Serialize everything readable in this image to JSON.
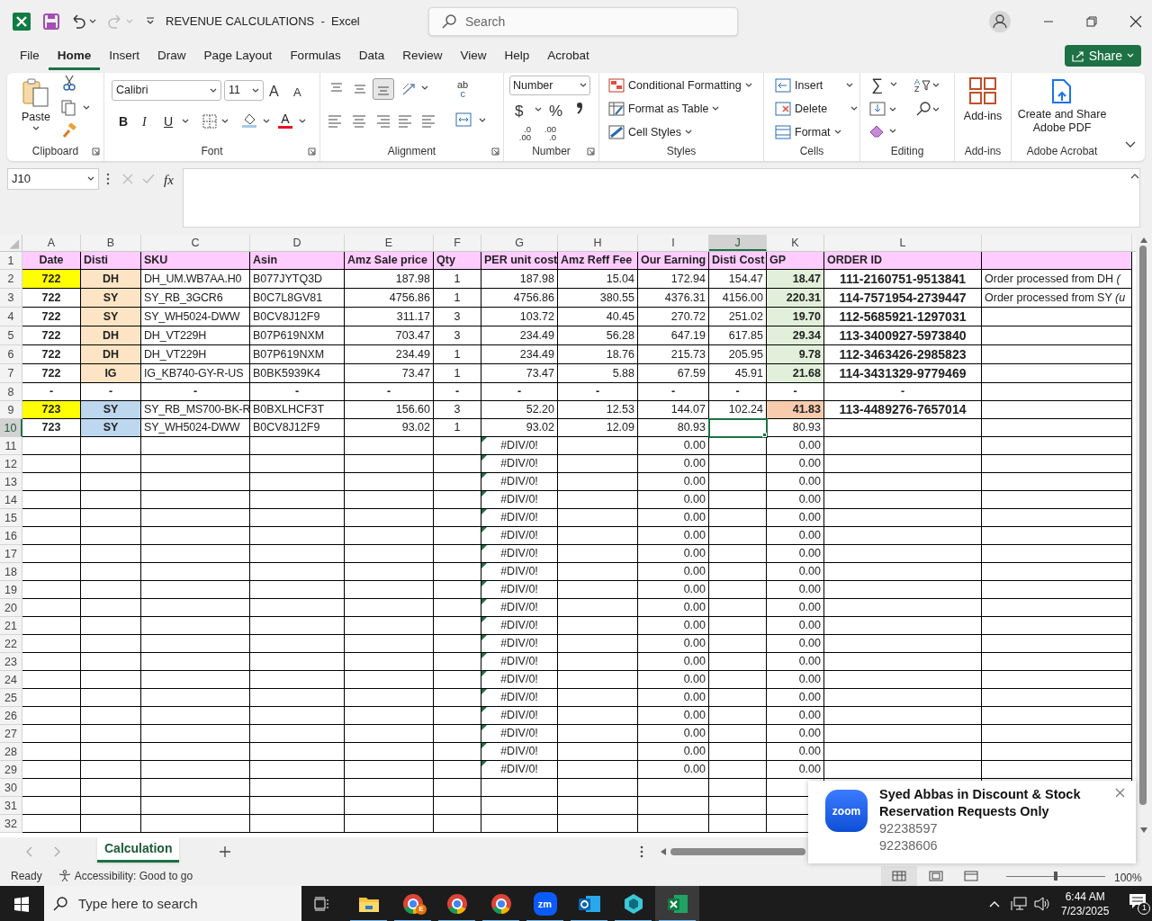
{
  "title_bar": {
    "title": "REVENUE CALCULATIONS  -  Excel",
    "search_placeholder": "Search"
  },
  "menu_tabs": [
    {
      "label": "File",
      "selected": false
    },
    {
      "label": "Home",
      "selected": true
    },
    {
      "label": "Insert",
      "selected": false
    },
    {
      "label": "Draw",
      "selected": false
    },
    {
      "label": "Page Layout",
      "selected": false
    },
    {
      "label": "Formulas",
      "selected": false
    },
    {
      "label": "Data",
      "selected": false
    },
    {
      "label": "Review",
      "selected": false
    },
    {
      "label": "View",
      "selected": false
    },
    {
      "label": "Help",
      "selected": false
    },
    {
      "label": "Acrobat",
      "selected": false
    }
  ],
  "share_button": "Share",
  "ribbon": {
    "paste": "Paste",
    "font_name": "Calibri",
    "font_size": "11",
    "grow_shrink": [
      "A",
      "A"
    ],
    "font_buttons": [
      "B",
      "I",
      "U"
    ],
    "font_color": "A",
    "vertical_align": [
      {
        "selected": false
      },
      {
        "selected": false
      },
      {
        "selected": true
      }
    ],
    "wrap_icon": [
      "ab",
      "c"
    ],
    "number_format": "Number",
    "number_symbols": [
      "$",
      "%"
    ],
    "decimal_buttons": [
      {
        "top": ".0",
        "bottom": ".00"
      },
      {
        "top": ".00",
        "bottom": ".0"
      }
    ],
    "styles": [
      "Conditional Formatting",
      "Format as Table",
      "Cell Styles"
    ],
    "cells": [
      "Insert",
      "Delete",
      "Format"
    ],
    "autosum": "∑",
    "sort_icon": [
      "A",
      "Z"
    ],
    "add_ins": "Add-ins",
    "acrobat": "Create and Share Adobe PDF",
    "group_labels": [
      "Clipboard",
      "Font",
      "Alignment",
      "Number",
      "Styles",
      "Cells",
      "Editing",
      "Add-ins",
      "Adobe Acrobat"
    ]
  },
  "formula_bar": {
    "name_box": "J10",
    "fx": "fx"
  },
  "sheet": {
    "columns": [
      {
        "letter": "A",
        "selected": false
      },
      {
        "letter": "B",
        "selected": false
      },
      {
        "letter": "C",
        "selected": false
      },
      {
        "letter": "D",
        "selected": false
      },
      {
        "letter": "E",
        "selected": false
      },
      {
        "letter": "F",
        "selected": false
      },
      {
        "letter": "G",
        "selected": false
      },
      {
        "letter": "H",
        "selected": false
      },
      {
        "letter": "I",
        "selected": false
      },
      {
        "letter": "J",
        "selected": true
      },
      {
        "letter": "K",
        "selected": false
      },
      {
        "letter": "L",
        "selected": false
      }
    ],
    "rows": [
      {
        "number": "1",
        "kind": "header",
        "selected": false,
        "color": "#ffccff",
        "cells": {
          "A": "Date",
          "B": "Disti",
          "C": "SKU",
          "D": "Asin",
          "E": "Amz Sale price",
          "F": "Qty",
          "G": "PER unit cost",
          "H": "Amz Reff Fee",
          "I": "Our Earning",
          "J": "Disti Cost",
          "K": "GP",
          "L": "ORDER ID"
        }
      },
      {
        "number": "2",
        "kind": "data",
        "selected": false,
        "cells": {
          "A": {
            "text": "722",
            "color": "#ffff00"
          },
          "B": {
            "text": "DH",
            "color": "#fce4c4"
          },
          "C": "DH_UM.WB7AA.H0",
          "D": "B077JYTQ3D",
          "E": "187.98",
          "F": "1",
          "G": "187.98",
          "H": "15.04",
          "I": "172.94",
          "J": "154.47",
          "K": {
            "text": "18.47",
            "color": "#e2efda"
          },
          "L": "111-2160751-9513841",
          "M": "Order processed from DH *(*"
        }
      },
      {
        "number": "3",
        "kind": "data",
        "selected": false,
        "cells": {
          "A": "722",
          "B": {
            "text": "SY",
            "color": "#fce4c4"
          },
          "C": "SY_RB_3GCR6",
          "D": "B0C7L8GV81",
          "E": "4756.86",
          "F": "1",
          "G": "4756.86",
          "H": "380.55",
          "I": "4376.31",
          "J": "4156.00",
          "K": {
            "text": "220.31",
            "color": "#e2efda"
          },
          "L": "114-7571954-2739447",
          "M": "Order processed from SY *(u*"
        }
      },
      {
        "number": "4",
        "kind": "data",
        "selected": false,
        "cells": {
          "A": "722",
          "B": {
            "text": "SY",
            "color": "#fce4c4"
          },
          "C": "SY_WH5024-DWW",
          "D": "B0CV8J12F9",
          "E": "311.17",
          "F": "3",
          "G": "103.72",
          "H": "40.45",
          "I": "270.72",
          "J": "251.02",
          "K": {
            "text": "19.70",
            "color": "#e2efda"
          },
          "L": "112-5685921-1297031"
        }
      },
      {
        "number": "5",
        "kind": "data",
        "selected": false,
        "cells": {
          "A": "722",
          "B": {
            "text": "DH",
            "color": "#fce4c4"
          },
          "C": "DH_VT229H",
          "D": "B07P619NXM",
          "E": "703.47",
          "F": "3",
          "G": "234.49",
          "H": "56.28",
          "I": "647.19",
          "J": "617.85",
          "K": {
            "text": "29.34",
            "color": "#e2efda"
          },
          "L": "113-3400927-5973840"
        }
      },
      {
        "number": "6",
        "kind": "data",
        "selected": false,
        "cells": {
          "A": "722",
          "B": {
            "text": "DH",
            "color": "#fce4c4"
          },
          "C": "DH_VT229H",
          "D": "B07P619NXM",
          "E": "234.49",
          "F": "1",
          "G": "234.49",
          "H": "18.76",
          "I": "215.73",
          "J": "205.95",
          "K": {
            "text": "9.78",
            "color": "#e2efda"
          },
          "L": "112-3463426-2985823"
        }
      },
      {
        "number": "7",
        "kind": "data",
        "selected": false,
        "cells": {
          "A": "722",
          "B": {
            "text": "IG",
            "color": "#fce4c4"
          },
          "C": "IG_KB740-GY-R-US",
          "D": "B0BK5939K4",
          "E": "73.47",
          "F": "1",
          "G": "73.47",
          "H": "5.88",
          "I": "67.59",
          "J": "45.91",
          "K": {
            "text": "21.68",
            "color": "#e2efda"
          },
          "L": "114-3431329-9779469"
        }
      },
      {
        "number": "8",
        "kind": "separator",
        "selected": false,
        "cells": {
          "A": "-",
          "B": "-",
          "C": "-",
          "D": "-",
          "E": "-",
          "F": "-",
          "G": "-",
          "H": "-",
          "I": "-",
          "J": "-",
          "K": "-",
          "L": "-"
        }
      },
      {
        "number": "9",
        "kind": "data",
        "selected": false,
        "cells": {
          "A": {
            "text": "723",
            "color": "#ffff00"
          },
          "B": {
            "text": "SY",
            "color": "#bdd7ee"
          },
          "C": "SY_RB_MS700-BK-R",
          "D": "B0BXLHCF3T",
          "E": "156.60",
          "F": "3",
          "G": "52.20",
          "H": "12.53",
          "I": "144.07",
          "J": "102.24",
          "K": {
            "text": "41.83",
            "color": "#f8cbad"
          },
          "L": "113-4489276-7657014"
        }
      },
      {
        "number": "10",
        "kind": "data",
        "selected": true,
        "cells": {
          "A": "723",
          "B": {
            "text": "SY",
            "color": "#bdd7ee"
          },
          "C": "SY_WH5024-DWW",
          "D": "B0CV8J12F9",
          "E": "93.02",
          "F": "1",
          "G": "93.02",
          "H": "12.09",
          "I": "80.93",
          "J": {
            "active": true
          },
          "K": "80.93"
        }
      },
      {
        "number": "11",
        "kind": "data",
        "selected": false,
        "cells": {
          "G": {
            "text": "#DIV/0!",
            "error": true
          },
          "I": "0.00",
          "K": "0.00"
        }
      },
      {
        "number": "12",
        "kind": "data",
        "selected": false,
        "cells": {
          "G": {
            "text": "#DIV/0!",
            "error": true
          },
          "I": "0.00",
          "K": "0.00"
        }
      },
      {
        "number": "13",
        "kind": "data",
        "selected": false,
        "cells": {
          "G": {
            "text": "#DIV/0!",
            "error": true
          },
          "I": "0.00",
          "K": "0.00"
        }
      },
      {
        "number": "14",
        "kind": "data",
        "selected": false,
        "cells": {
          "G": {
            "text": "#DIV/0!",
            "error": true
          },
          "I": "0.00",
          "K": "0.00"
        }
      },
      {
        "number": "15",
        "kind": "data",
        "selected": false,
        "cells": {
          "G": {
            "text": "#DIV/0!",
            "error": true
          },
          "I": "0.00",
          "K": "0.00"
        }
      },
      {
        "number": "16",
        "kind": "data",
        "selected": false,
        "cells": {
          "G": {
            "text": "#DIV/0!",
            "error": true
          },
          "I": "0.00",
          "K": "0.00"
        }
      },
      {
        "number": "17",
        "kind": "data",
        "selected": false,
        "cells": {
          "G": {
            "text": "#DIV/0!",
            "error": true
          },
          "I": "0.00",
          "K": "0.00"
        }
      },
      {
        "number": "18",
        "kind": "data",
        "selected": false,
        "cells": {
          "G": {
            "text": "#DIV/0!",
            "error": true
          },
          "I": "0.00",
          "K": "0.00"
        }
      },
      {
        "number": "19",
        "kind": "data",
        "selected": false,
        "cells": {
          "G": {
            "text": "#DIV/0!",
            "error": true
          },
          "I": "0.00",
          "K": "0.00"
        }
      },
      {
        "number": "20",
        "kind": "data",
        "selected": false,
        "cells": {
          "G": {
            "text": "#DIV/0!",
            "error": true
          },
          "I": "0.00",
          "K": "0.00"
        }
      },
      {
        "number": "21",
        "kind": "data",
        "selected": false,
        "cells": {
          "G": {
            "text": "#DIV/0!",
            "error": true
          },
          "I": "0.00",
          "K": "0.00"
        }
      },
      {
        "number": "22",
        "kind": "data",
        "selected": false,
        "cells": {
          "G": {
            "text": "#DIV/0!",
            "error": true
          },
          "I": "0.00",
          "K": "0.00"
        }
      },
      {
        "number": "23",
        "kind": "data",
        "selected": false,
        "cells": {
          "G": {
            "text": "#DIV/0!",
            "error": true
          },
          "I": "0.00",
          "K": "0.00"
        }
      },
      {
        "number": "24",
        "kind": "data",
        "selected": false,
        "cells": {
          "G": {
            "text": "#DIV/0!",
            "error": true
          },
          "I": "0.00",
          "K": "0.00"
        }
      },
      {
        "number": "25",
        "kind": "data",
        "selected": false,
        "cells": {
          "G": {
            "text": "#DIV/0!",
            "error": true
          },
          "I": "0.00",
          "K": "0.00"
        }
      },
      {
        "number": "26",
        "kind": "data",
        "selected": false,
        "cells": {
          "G": {
            "text": "#DIV/0!",
            "error": true
          },
          "I": "0.00",
          "K": "0.00"
        }
      },
      {
        "number": "27",
        "kind": "data",
        "selected": false,
        "cells": {
          "G": {
            "text": "#DIV/0!",
            "error": true
          },
          "I": "0.00",
          "K": "0.00"
        }
      },
      {
        "number": "28",
        "kind": "data",
        "selected": false,
        "cells": {
          "G": {
            "text": "#DIV/0!",
            "error": true
          },
          "I": "0.00",
          "K": "0.00"
        }
      },
      {
        "number": "29",
        "kind": "data",
        "selected": false,
        "cells": {
          "G": {
            "text": "#DIV/0!",
            "error": true
          },
          "I": "0.00",
          "K": "0.00"
        }
      },
      {
        "number": "30",
        "kind": "data",
        "selected": false
      },
      {
        "number": "31",
        "kind": "data",
        "selected": false
      },
      {
        "number": "32",
        "kind": "data",
        "selected": false
      }
    ]
  },
  "sheet_tabs": [
    {
      "label": "Calculation",
      "selected": true
    }
  ],
  "status_bar": {
    "status": "Ready",
    "accessibility": "Accessibility: Good to go",
    "zoom_slider": {
      "level": 0.5
    },
    "zoom": "100%"
  },
  "notification": {
    "logo": "zoom",
    "title": "Syed Abbas in Discount & Stock Reservation Requests Only",
    "lines": [
      "92238597",
      "92238606"
    ]
  },
  "taskbar": {
    "search_placeholder": "Type here to search",
    "apps": [
      {
        "kind": "folder",
        "selected": false
      },
      {
        "kind": "chrome",
        "badge": "E",
        "selected": false
      },
      {
        "kind": "chrome",
        "selected": false
      },
      {
        "kind": "chrome",
        "selected": false
      },
      {
        "kind": "zoom",
        "label": "zm",
        "selected": false
      },
      {
        "kind": "outlook",
        "selected": false
      },
      {
        "kind": "app",
        "selected": false
      },
      {
        "kind": "excel",
        "selected": true
      }
    ],
    "time": "6:44 AM",
    "date": "7/23/2025",
    "notification_count": "1"
  }
}
